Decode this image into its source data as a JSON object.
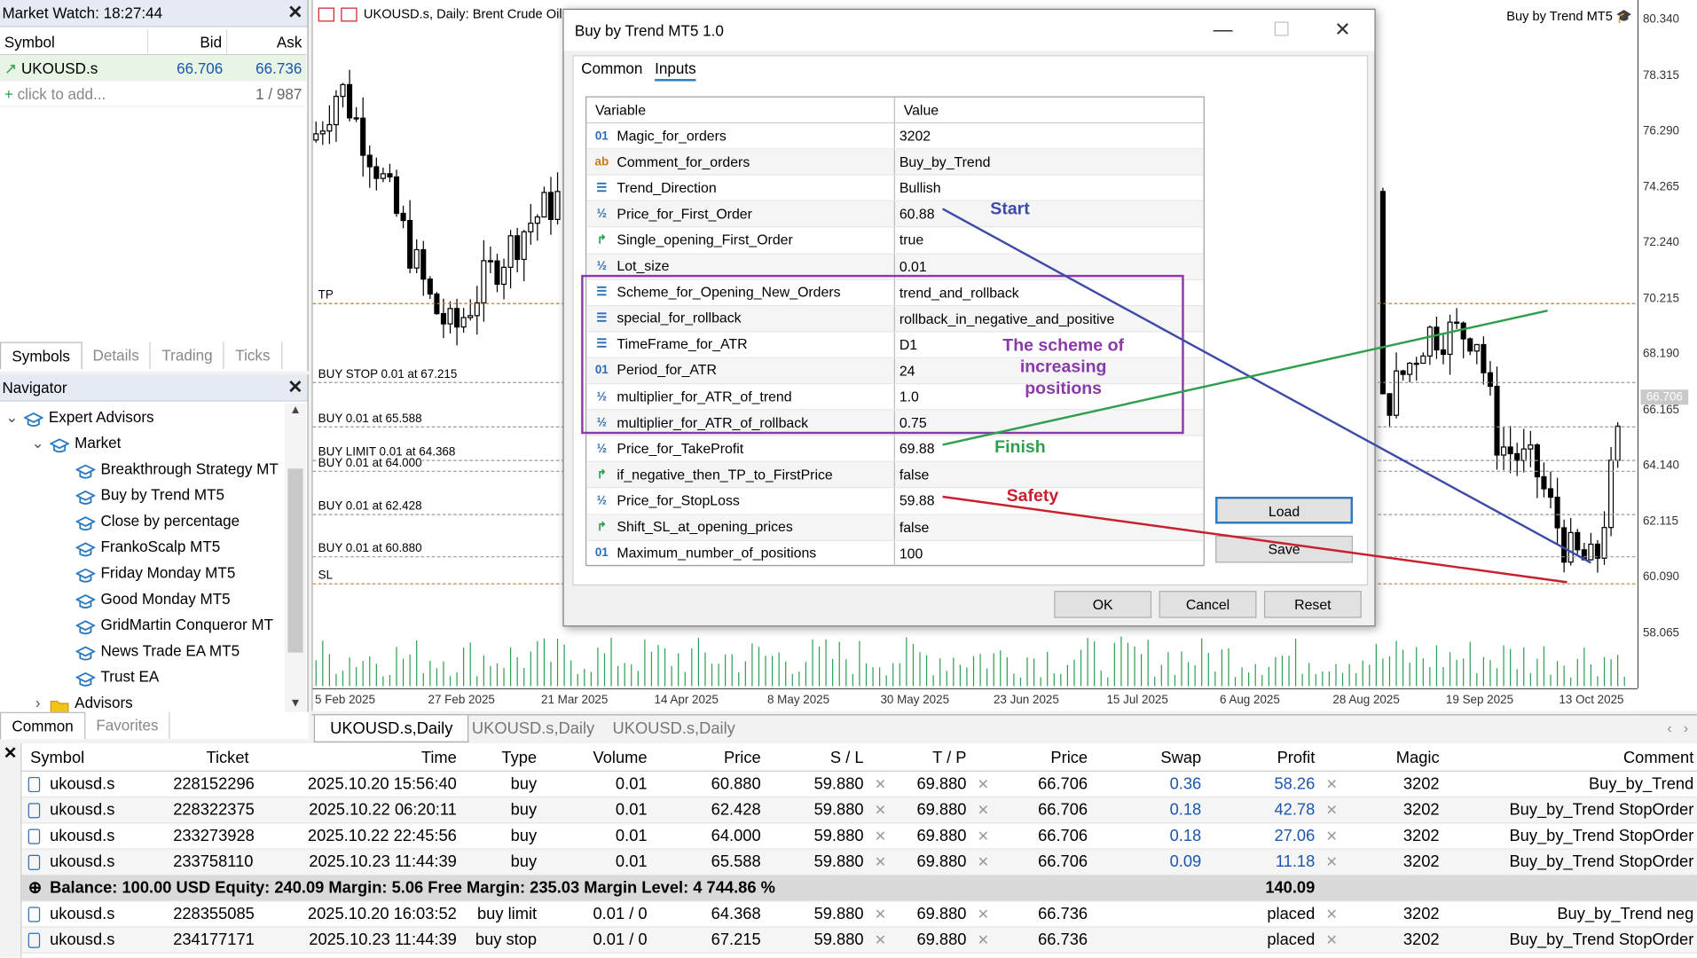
{
  "colors": {
    "panel_header": "#e6ebf3",
    "bull": "#2a7ac2",
    "bear": "#000000",
    "start": "#3d4aa6",
    "finish": "#2e9e4f",
    "safety": "#c8202c",
    "scheme": "#8a3aa8"
  },
  "market_watch": {
    "title": "Market Watch: 18:27:44",
    "cols": [
      "Symbol",
      "Bid",
      "Ask"
    ],
    "row": {
      "symbol": "UKOUSD.s",
      "bid": "66.706",
      "ask": "66.736"
    },
    "add": "click to add...",
    "count": "1 / 987",
    "tabs": [
      "Symbols",
      "Details",
      "Trading",
      "Ticks"
    ]
  },
  "navigator": {
    "title": "Navigator",
    "root": "Expert Advisors",
    "market": "Market",
    "items": [
      "Breakthrough Strategy MT",
      "Buy by Trend MT5",
      "Close by percentage",
      "FrankoScalp MT5",
      "Friday Monday MT5",
      "Good Monday MT5",
      "GridMartin Conqueror MT",
      "News Trade EA MT5",
      "Trust EA"
    ],
    "advisors": "Advisors",
    "tabs": [
      "Common",
      "Favorites"
    ]
  },
  "chart": {
    "header": "UKOUSD.s, Daily:  Brent Crude Oil",
    "ea_label": "Buy by Trend MT5",
    "levels": [
      {
        "label": "TP",
        "price": 70.08
      },
      {
        "label": "BUY STOP 0.01 at 67.215",
        "price": 67.215
      },
      {
        "label": "BUY 0.01 at 65.588",
        "price": 65.588
      },
      {
        "label": "BUY LIMIT 0.01 at 64.368",
        "price": 64.368
      },
      {
        "label": "BUY 0.01 at 64.000",
        "price": 64.0
      },
      {
        "label": "BUY 0.01 at 62.428",
        "price": 62.428
      },
      {
        "label": "BUY 0.01 at 60.880",
        "price": 60.88
      },
      {
        "label": "SL",
        "price": 59.88
      }
    ],
    "price_ticks": [
      "80.340",
      "78.315",
      "76.290",
      "74.265",
      "72.240",
      "70.215",
      "68.190",
      "66.165",
      "64.140",
      "62.115",
      "60.090",
      "58.065"
    ],
    "current_price": "66.706",
    "date_ticks": [
      "5 Feb 2025",
      "27 Feb 2025",
      "21 Mar 2025",
      "14 Apr 2025",
      "8 May 2025",
      "30 May 2025",
      "23 Jun 2025",
      "15 Jul 2025",
      "6 Aug 2025",
      "28 Aug 2025",
      "19 Sep 2025",
      "13 Oct 2025"
    ],
    "tabs": [
      "UKOUSD.s,Daily",
      "UKOUSD.s,Daily",
      "UKOUSD.s,Daily"
    ]
  },
  "dialog": {
    "title": "Buy by Trend MT5 1.0",
    "tabs": [
      "Common",
      "Inputs"
    ],
    "col_variable": "Variable",
    "col_value": "Value",
    "params": [
      {
        "icon": "int",
        "name": "Magic_for_orders",
        "value": "3202"
      },
      {
        "icon": "str",
        "name": "Comment_for_orders",
        "value": "Buy_by_Trend"
      },
      {
        "icon": "enum",
        "name": "Trend_Direction",
        "value": "Bullish"
      },
      {
        "icon": "dbl",
        "name": "Price_for_First_Order",
        "value": "60.88"
      },
      {
        "icon": "bool",
        "name": "Single_opening_First_Order",
        "value": "true"
      },
      {
        "icon": "dbl",
        "name": "Lot_size",
        "value": "0.01"
      },
      {
        "icon": "enum",
        "name": "Scheme_for_Opening_New_Orders",
        "value": "trend_and_rollback"
      },
      {
        "icon": "enum",
        "name": "special_for_rollback",
        "value": "rollback_in_negative_and_positive"
      },
      {
        "icon": "enum",
        "name": "TimeFrame_for_ATR",
        "value": "D1"
      },
      {
        "icon": "int",
        "name": "Period_for_ATR",
        "value": "24"
      },
      {
        "icon": "dbl",
        "name": "multiplier_for_ATR_of_trend",
        "value": "1.0"
      },
      {
        "icon": "dbl",
        "name": "multiplier_for_ATR_of_rollback",
        "value": "0.75"
      },
      {
        "icon": "dbl",
        "name": "Price_for_TakeProfit",
        "value": "69.88"
      },
      {
        "icon": "bool",
        "name": "if_negative_then_TP_to_FirstPrice",
        "value": "false"
      },
      {
        "icon": "dbl",
        "name": "Price_for_StopLoss",
        "value": "59.88"
      },
      {
        "icon": "bool",
        "name": "Shift_SL_at_opening_prices",
        "value": "false"
      },
      {
        "icon": "int",
        "name": "Maximum_number_of_positions",
        "value": "100"
      }
    ],
    "buttons": {
      "load": "Load",
      "save": "Save",
      "ok": "OK",
      "cancel": "Cancel",
      "reset": "Reset"
    }
  },
  "annotations": {
    "start": "Start",
    "scheme": "The scheme of\nincreasing\npositions",
    "finish": "Finish",
    "safety": "Safety"
  },
  "icons": {
    "int": "01",
    "str": "ab",
    "enum": "☰",
    "dbl": "½",
    "bool": "↱"
  },
  "trade": {
    "cols": [
      "Symbol",
      "Ticket",
      "Time",
      "Type",
      "Volume",
      "Price",
      "S / L",
      "T / P",
      "Price",
      "Swap",
      "Profit",
      "Magic",
      "Comment"
    ],
    "positions": [
      {
        "symbol": "ukousd.s",
        "ticket": "228152296",
        "time": "2025.10.20 15:56:40",
        "type": "buy",
        "volume": "0.01",
        "price": "60.880",
        "sl": "59.880",
        "tp": "69.880",
        "cur": "66.706",
        "swap": "0.36",
        "profit": "58.26",
        "magic": "3202",
        "comment": "Buy_by_Trend"
      },
      {
        "symbol": "ukousd.s",
        "ticket": "228322375",
        "time": "2025.10.22 06:20:11",
        "type": "buy",
        "volume": "0.01",
        "price": "62.428",
        "sl": "59.880",
        "tp": "69.880",
        "cur": "66.706",
        "swap": "0.18",
        "profit": "42.78",
        "magic": "3202",
        "comment": "Buy_by_Trend StopOrder"
      },
      {
        "symbol": "ukousd.s",
        "ticket": "233273928",
        "time": "2025.10.22 22:45:56",
        "type": "buy",
        "volume": "0.01",
        "price": "64.000",
        "sl": "59.880",
        "tp": "69.880",
        "cur": "66.706",
        "swap": "0.18",
        "profit": "27.06",
        "magic": "3202",
        "comment": "Buy_by_Trend StopOrder"
      },
      {
        "symbol": "ukousd.s",
        "ticket": "233758110",
        "time": "2025.10.23 11:44:39",
        "type": "buy",
        "volume": "0.01",
        "price": "65.588",
        "sl": "59.880",
        "tp": "69.880",
        "cur": "66.706",
        "swap": "0.09",
        "profit": "11.18",
        "magic": "3202",
        "comment": "Buy_by_Trend StopOrder"
      }
    ],
    "balance": "Balance: 100.00 USD  Equity: 240.09  Margin: 5.06  Free Margin: 235.03  Margin Level: 4 744.86 %",
    "total_profit": "140.09",
    "orders": [
      {
        "symbol": "ukousd.s",
        "ticket": "228355085",
        "time": "2025.10.20 16:03:52",
        "type": "buy limit",
        "volume": "0.01 / 0",
        "price": "64.368",
        "sl": "59.880",
        "tp": "69.880",
        "cur": "66.736",
        "profit": "placed",
        "magic": "3202",
        "comment": "Buy_by_Trend neg"
      },
      {
        "symbol": "ukousd.s",
        "ticket": "234177171",
        "time": "2025.10.23 11:44:39",
        "type": "buy stop",
        "volume": "0.01 / 0",
        "price": "67.215",
        "sl": "59.880",
        "tp": "69.880",
        "cur": "66.736",
        "profit": "placed",
        "magic": "3202",
        "comment": "Buy_by_Trend StopOrder"
      }
    ]
  }
}
